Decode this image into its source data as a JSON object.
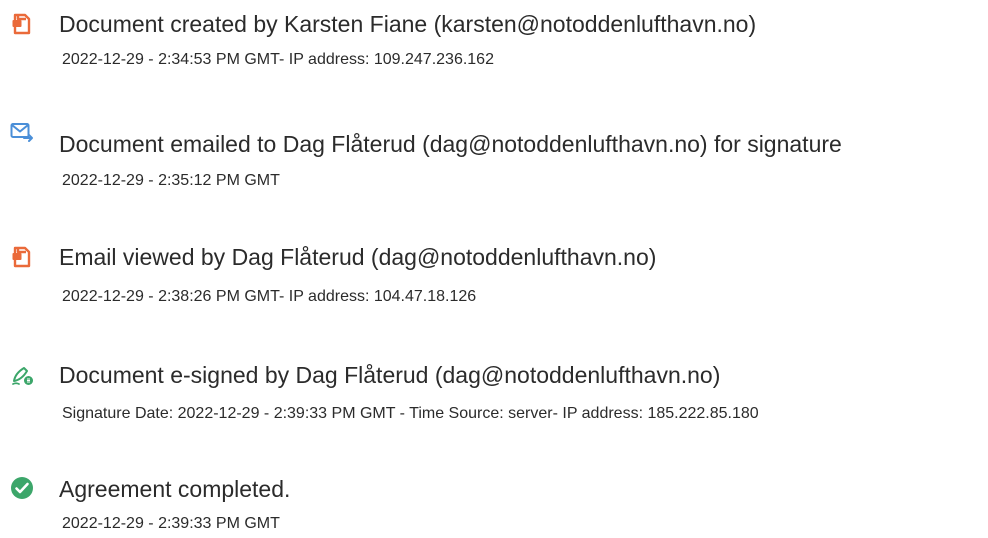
{
  "colors": {
    "doc_icon": "#ea6a3a",
    "email_icon": "#4b8fd8",
    "sign_icon": "#3ca66a",
    "complete_icon": "#3ca66a",
    "text": "#2b2b2b"
  },
  "events": [
    {
      "icon": "document-created-icon",
      "title": "Document created by Karsten Fiane (karsten@notoddenlufthavn.no)",
      "detail": "2022-12-29 - 2:34:53 PM GMT- IP address: 109.247.236.162"
    },
    {
      "icon": "email-sent-icon",
      "title": "Document emailed to Dag Flåterud (dag@notoddenlufthavn.no) for signature",
      "detail": "2022-12-29 - 2:35:12 PM GMT"
    },
    {
      "icon": "document-viewed-icon",
      "title": "Email viewed by Dag Flåterud (dag@notoddenlufthavn.no)",
      "detail": "2022-12-29 - 2:38:26 PM GMT- IP address: 104.47.18.126"
    },
    {
      "icon": "pen-signed-icon",
      "title": "Document e-signed by Dag Flåterud (dag@notoddenlufthavn.no)",
      "detail": "Signature Date: 2022-12-29 - 2:39:33 PM GMT - Time Source: server- IP address: 185.222.85.180"
    },
    {
      "icon": "check-circle-icon",
      "title": "Agreement completed.",
      "detail": "2022-12-29 - 2:39:33 PM GMT"
    }
  ]
}
